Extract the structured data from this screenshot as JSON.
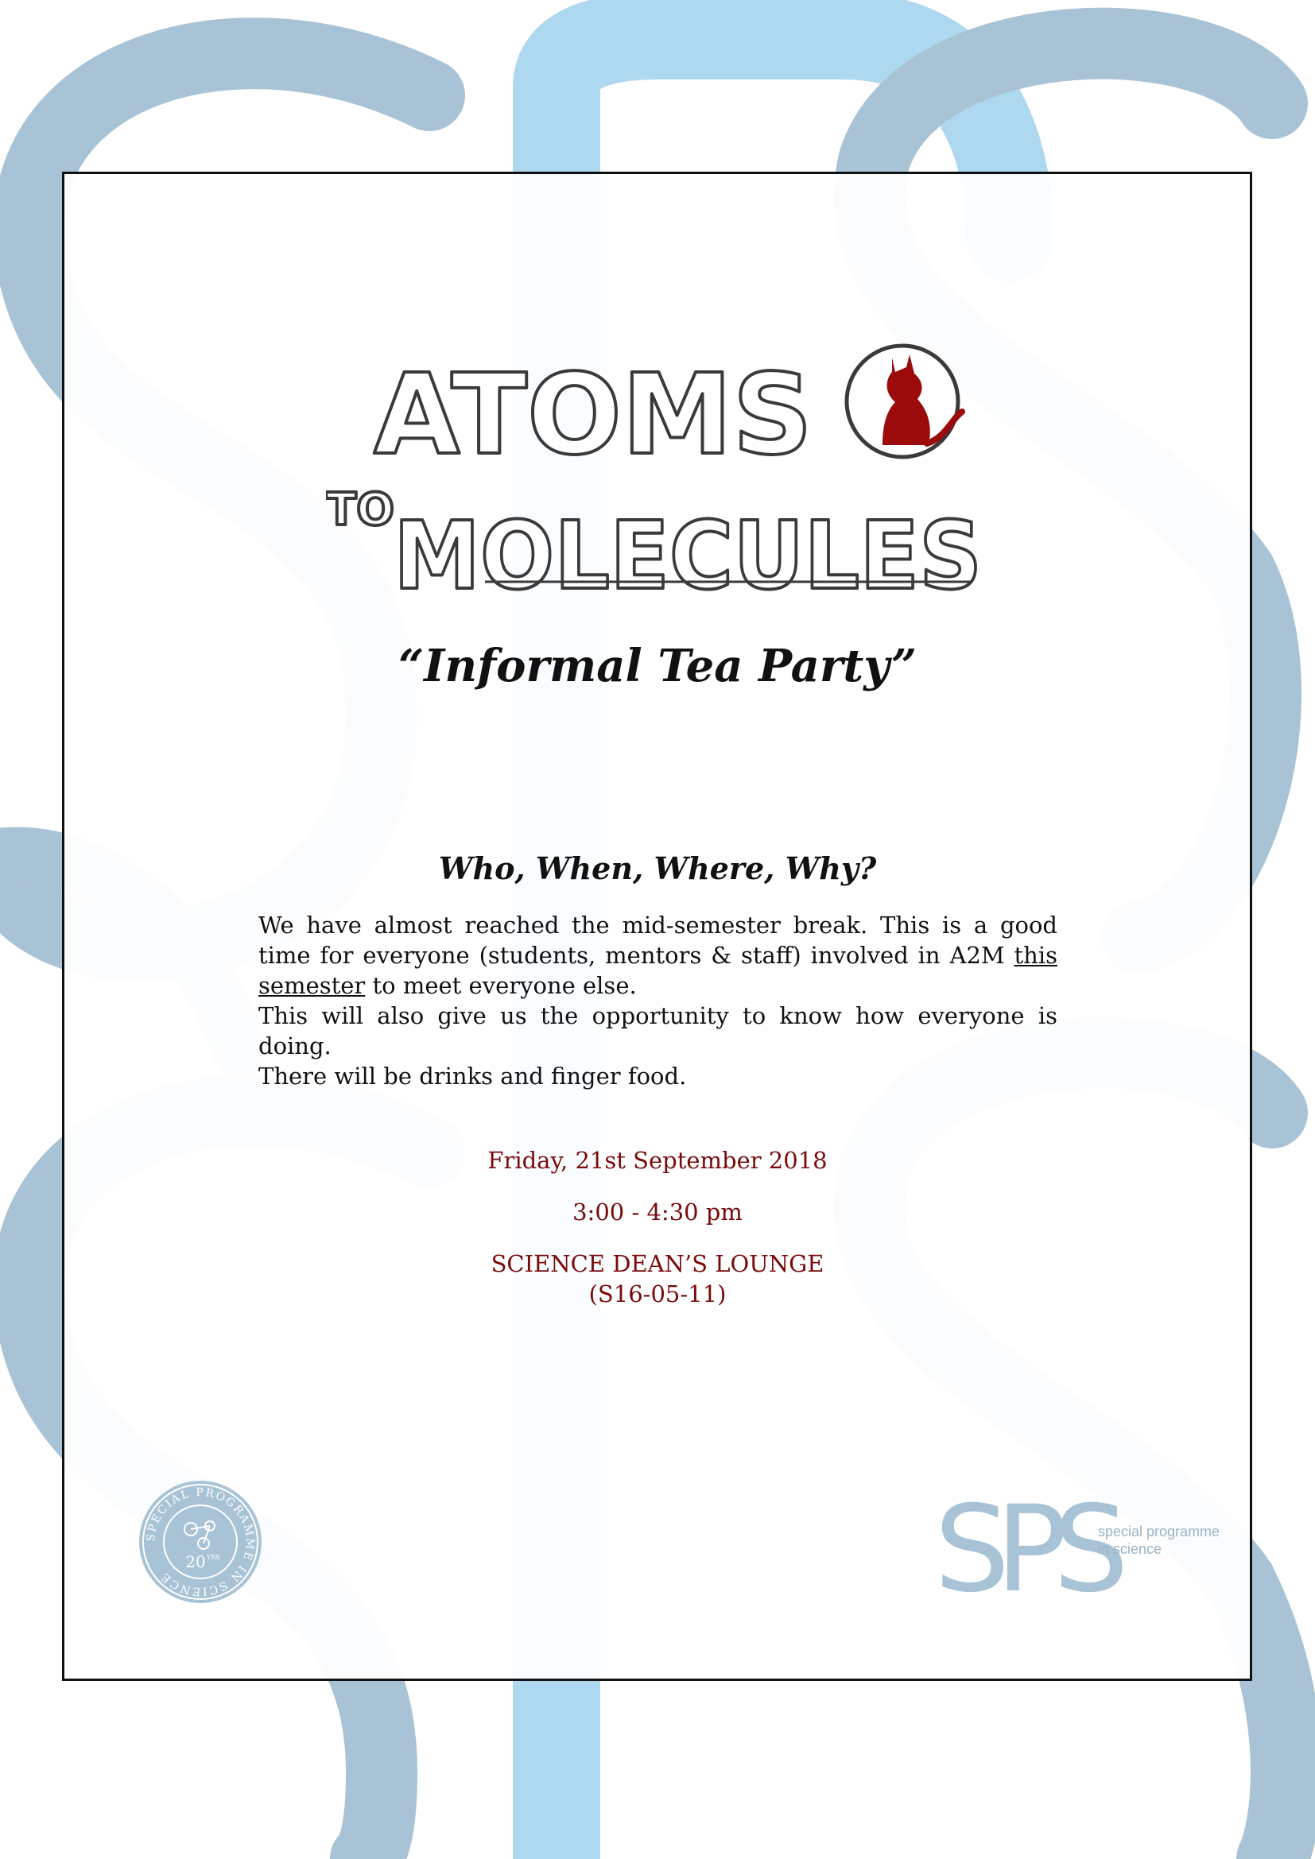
{
  "logo": {
    "line1": "ATOMS",
    "line2_prefix": "TO",
    "line2": "MOLECULES"
  },
  "title": "“Informal Tea Party”",
  "section_heading": "Who, When, Where, Why?",
  "body": {
    "p1_part1": "We have almost reached the mid-semester break.  This is a good time for everyone (students, mentors & staff) involved in A2M ",
    "p1_underlined": "this semester",
    "p1_part2": " to meet everyone else.",
    "p2": "This will also give us the opportunity to know how everyone is doing.",
    "p3": "There will be drinks and finger food."
  },
  "event": {
    "date": "Friday, 21st September 2018",
    "time": "3:00 - 4:30 pm",
    "venue": "SCIENCE DEAN’S LOUNGE",
    "room": "(S16-05-11)"
  },
  "seal": {
    "ring_text": "SPECIAL PROGRAMME IN SCIENCE",
    "center": "20",
    "center_sup": "YRS"
  },
  "sps": {
    "letters": "SPS",
    "tagline1": "special programme",
    "tagline2": "in science"
  },
  "colors": {
    "accent": "#7a0a0a",
    "watermark_dark": "#a9c3d6",
    "watermark_light": "#aed8f0",
    "cat": "#9b0b0b"
  }
}
